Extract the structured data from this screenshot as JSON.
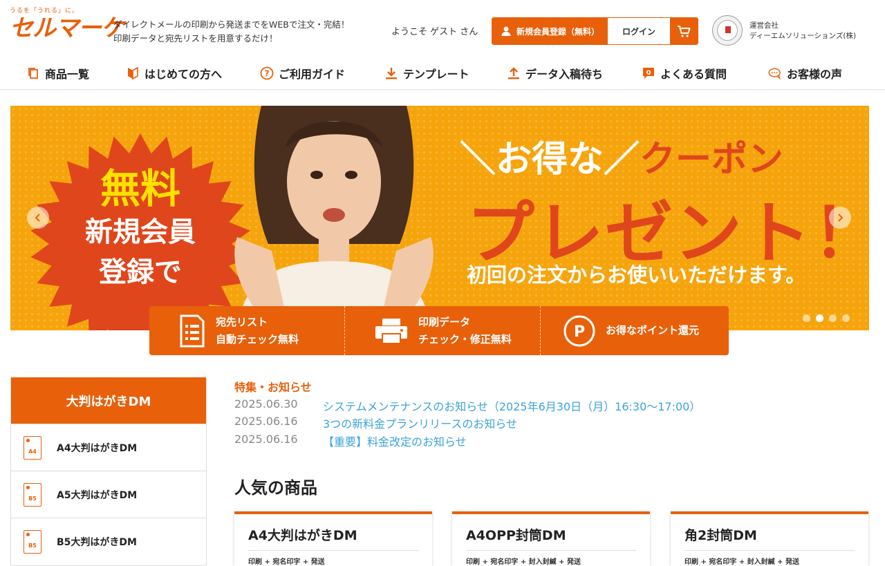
{
  "header": {
    "logo_tag": "うるを「うれる」に。",
    "logo_text": "セルマーケ",
    "tagline_1": "ダイレクトメールの印刷から発送までをWEBで注文・完結！",
    "tagline_2": "印刷データと宛先リストを用意するだけ！",
    "welcome": "ようこそ ゲスト さん",
    "register_label": "新規会員登録（無料）",
    "login_label": "ログイン",
    "company_label": "運営会社",
    "company_name": "ディーエムソリューションズ(株)"
  },
  "nav": {
    "items": [
      {
        "label": "商品一覧",
        "icon": "copy-icon"
      },
      {
        "label": "はじめての方へ",
        "icon": "beginner-mark-icon"
      },
      {
        "label": "ご利用ガイド",
        "icon": "question-circle-icon"
      },
      {
        "label": "テンプレート",
        "icon": "download-icon"
      },
      {
        "label": "データ入稿待ち",
        "icon": "upload-icon"
      },
      {
        "label": "よくある質問",
        "icon": "faq-icon"
      },
      {
        "label": "お客様の声",
        "icon": "chat-bubble-icon"
      }
    ]
  },
  "hero": {
    "burst_1": "無料",
    "burst_2": "新規会員",
    "burst_3": "登録で",
    "headline_1": "＼お得な／",
    "headline_1b": "クーポン",
    "headline_2": "プレゼント！",
    "headline_3": "初回の注文からお使いいただけます。",
    "pager_count": 4,
    "pager_active_index": 1
  },
  "features": [
    {
      "line1": "宛先リスト",
      "line2": "自動チェック無料",
      "icon": "list-document-icon"
    },
    {
      "line1": "印刷データ",
      "line2": "チェック・修正無料",
      "icon": "printer-icon"
    },
    {
      "line1": "お得なポイント還元",
      "line2": "",
      "icon": "point-icon"
    }
  ],
  "sidebar": {
    "title": "大判はがきDM",
    "items": [
      {
        "label": "A4大判はがきDM",
        "badge": "A4"
      },
      {
        "label": "A5大判はがきDM",
        "badge": "B5"
      },
      {
        "label": "B5大判はがきDM",
        "badge": "B5"
      }
    ]
  },
  "news": {
    "title": "特集・お知らせ",
    "items": [
      {
        "date": "2025.06.30",
        "text": "システムメンテナンスのお知らせ（2025年6月30日（月）16:30～17:00）"
      },
      {
        "date": "2025.06.16",
        "text": "3つの新料金プランリリースのお知らせ"
      },
      {
        "date": "2025.06.16",
        "text": "【重要】料金改定のお知らせ"
      }
    ]
  },
  "popular": {
    "title": "人気の商品",
    "cards": [
      {
        "title": "A4大判はがきDM",
        "sub": "印刷 + 宛名印字 + 発送"
      },
      {
        "title": "A4OPP封筒DM",
        "sub": "印刷 + 宛名印字 + 封入封緘 + 発送"
      },
      {
        "title": "角2封筒DM",
        "sub": "印刷 + 宛名印字 + 封入封緘 + 発送"
      }
    ]
  },
  "colors": {
    "brand": "#e8600a",
    "hero_bg": "#f6a40c",
    "hero_red": "#e0461b",
    "link": "#3ba3d7"
  }
}
